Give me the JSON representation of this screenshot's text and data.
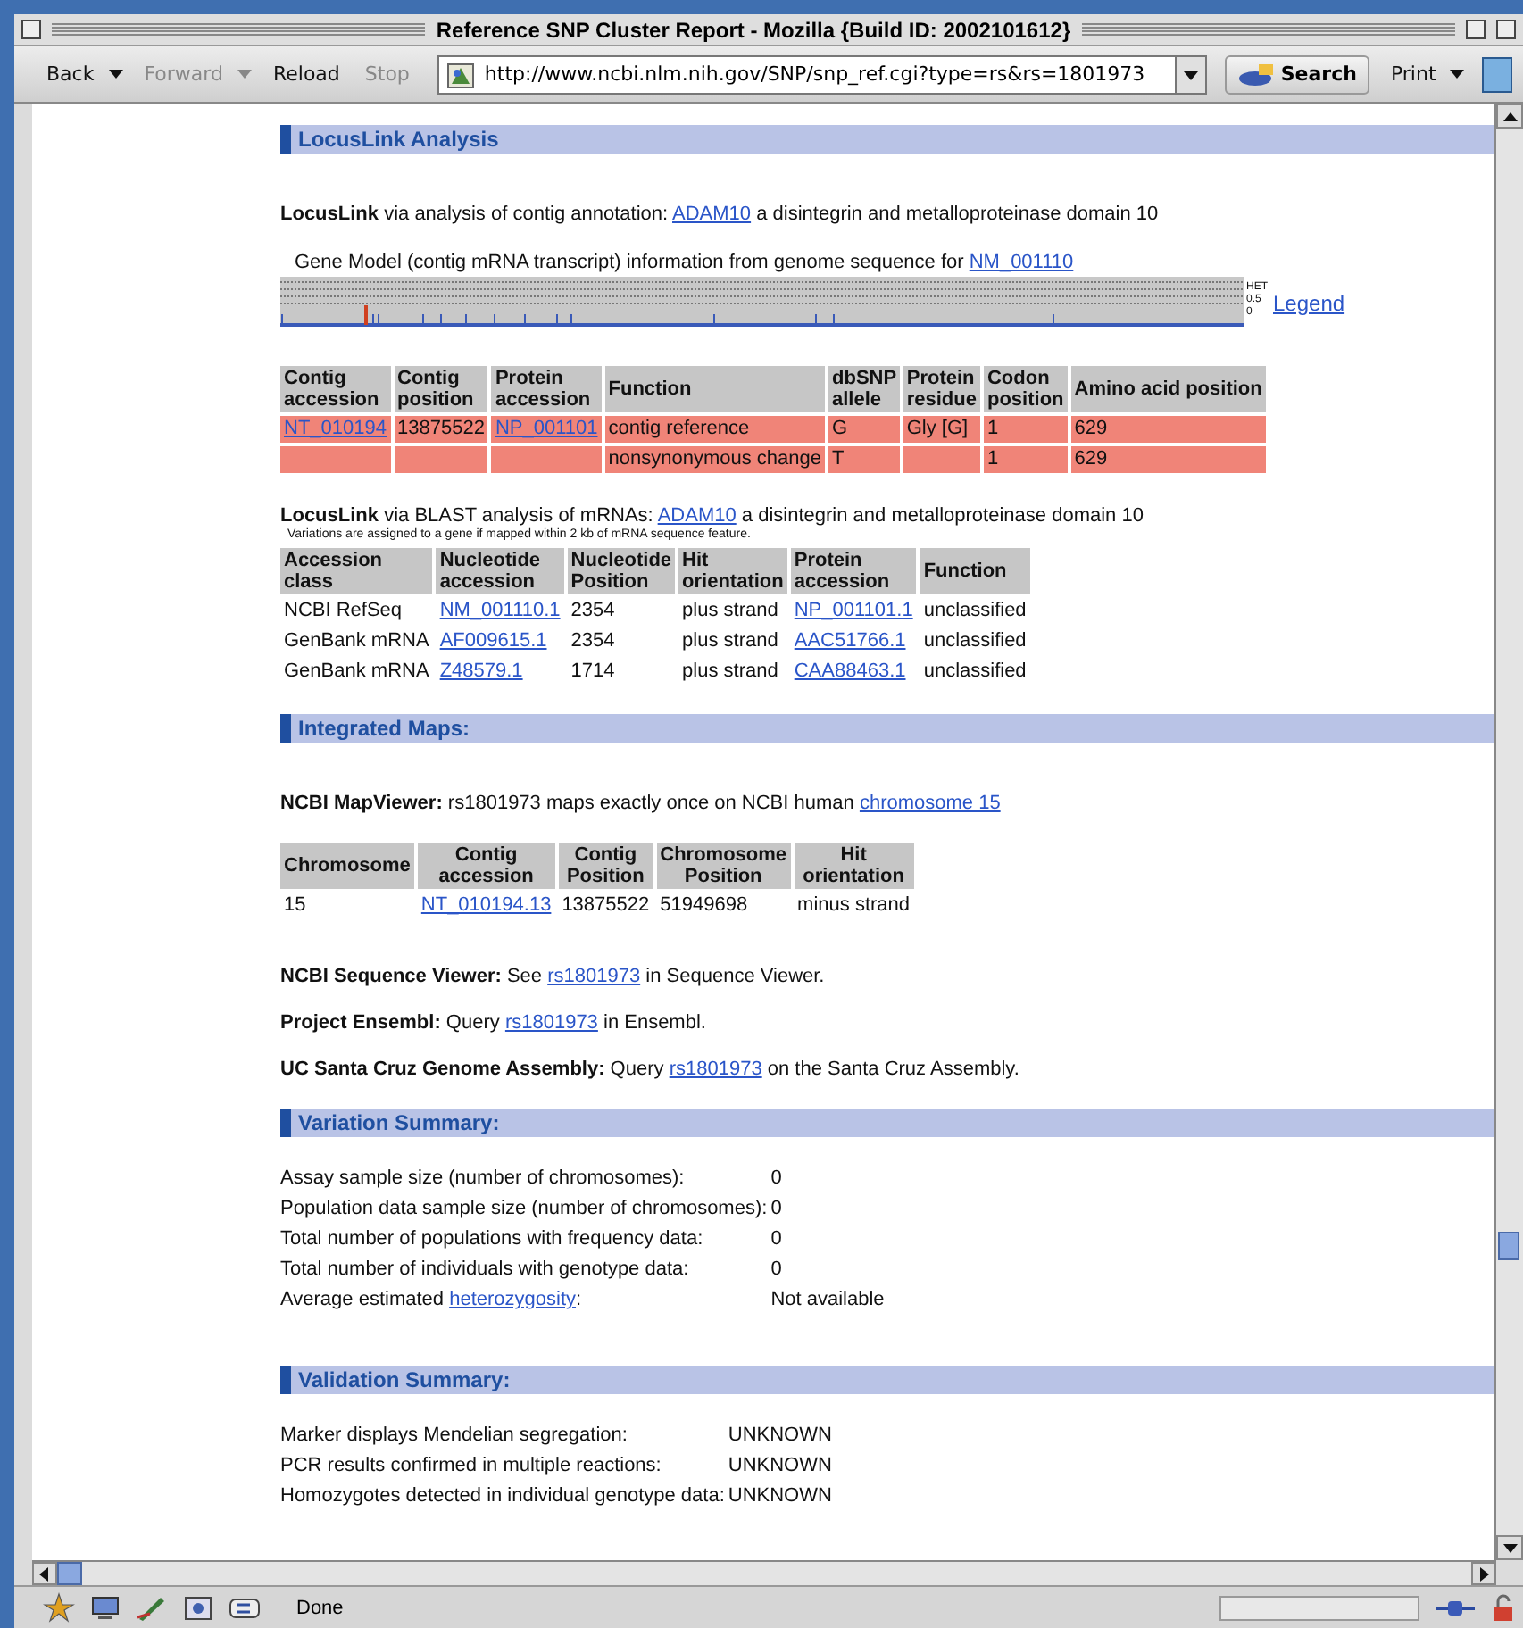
{
  "window": {
    "title": "Reference SNP Cluster Report - Mozilla {Build ID: 2002101612}"
  },
  "toolbar": {
    "buttons": [
      {
        "label": "Back",
        "disabled": false,
        "menu": true
      },
      {
        "label": "Forward",
        "disabled": true,
        "menu": true
      },
      {
        "label": "Reload",
        "disabled": false,
        "menu": false
      },
      {
        "label": "Stop",
        "disabled": true,
        "menu": false
      }
    ],
    "url": "http://www.ncbi.nlm.nih.gov/SNP/snp_ref.cgi?type=rs&rs=1801973",
    "search": "Search",
    "print": "Print"
  },
  "sections": [
    {
      "heading": "LocusLink Analysis",
      "blocks": [
        {
          "kind": "paragraph",
          "parts": [
            {
              "kind": "bold",
              "text": "LocusLink"
            },
            {
              "kind": "plain",
              "text": " via analysis of contig annotation: "
            },
            {
              "kind": "link",
              "text": "ADAM10"
            },
            {
              "kind": "plain",
              "text": " a disintegrin and metalloproteinase domain 10"
            }
          ]
        },
        {
          "kind": "gene_model",
          "parts": [
            {
              "kind": "plain",
              "text": "Gene Model (contig mRNA transcript) information from genome sequence for "
            },
            {
              "kind": "link",
              "text": "NM_001110"
            }
          ],
          "scale": [
            "HET",
            "0.5",
            "0"
          ],
          "legend": "Legend"
        },
        {
          "kind": "highlight_table",
          "columns": [
            "Contig accession",
            "Contig position",
            "Protein accession",
            "Function",
            "dbSNP allele",
            "Protein residue",
            "Codon position",
            "Amino acid position"
          ],
          "rows": [
            [
              {
                "kind": "link",
                "text": "NT_010194"
              },
              "13875522",
              {
                "kind": "link",
                "text": "NP_001101"
              },
              "contig reference",
              "G",
              "Gly [G]",
              "1",
              "629"
            ],
            [
              null,
              null,
              null,
              "nonsynonymous change",
              "T",
              null,
              "1",
              "629"
            ]
          ]
        },
        {
          "kind": "paragraph",
          "parts": [
            {
              "kind": "bold",
              "text": "LocusLink"
            },
            {
              "kind": "plain",
              "text": " via BLAST analysis of mRNAs: "
            },
            {
              "kind": "link",
              "text": "ADAM10"
            },
            {
              "kind": "plain",
              "text": " a disintegrin and metalloproteinase domain 10"
            }
          ]
        },
        {
          "kind": "note",
          "text": "Variations are assigned to a gene if mapped within 2 kb of mRNA sequence feature."
        },
        {
          "kind": "table",
          "columns": [
            "Accession class",
            "Nucleotide accession",
            "Nucleotide Position",
            "Hit orientation",
            "Protein accession",
            "Function"
          ],
          "rows": [
            [
              "NCBI RefSeq",
              {
                "kind": "link",
                "text": "NM_001110.1"
              },
              "2354",
              "plus strand",
              {
                "kind": "link",
                "text": "NP_001101.1"
              },
              "unclassified"
            ],
            [
              "GenBank mRNA",
              {
                "kind": "link",
                "text": "AF009615.1"
              },
              "2354",
              "plus strand",
              {
                "kind": "link",
                "text": "AAC51766.1"
              },
              "unclassified"
            ],
            [
              "GenBank mRNA",
              {
                "kind": "link",
                "text": "Z48579.1"
              },
              "1714",
              "plus strand",
              {
                "kind": "link",
                "text": "CAA88463.1"
              },
              "unclassified"
            ]
          ]
        }
      ]
    },
    {
      "heading": "Integrated Maps:",
      "blocks": [
        {
          "kind": "paragraph",
          "parts": [
            {
              "kind": "bold",
              "text": "NCBI MapViewer:"
            },
            {
              "kind": "plain",
              "text": "  rs1801973 maps exactly once on NCBI human "
            },
            {
              "kind": "link",
              "text": "chromosome 15"
            }
          ]
        },
        {
          "kind": "centered_table",
          "columns": [
            "Chromosome",
            "Contig accession",
            "Contig Position",
            "Chromosome Position",
            "Hit orientation"
          ],
          "rows": [
            [
              "15",
              {
                "kind": "link",
                "text": "NT_010194.13"
              },
              "13875522",
              "51949698",
              "minus strand"
            ]
          ]
        },
        {
          "kind": "paragraph",
          "parts": [
            {
              "kind": "bold",
              "text": "NCBI Sequence Viewer:"
            },
            {
              "kind": "plain",
              "text": " See "
            },
            {
              "kind": "link",
              "text": "rs1801973"
            },
            {
              "kind": "plain",
              "text": " in Sequence Viewer."
            }
          ]
        },
        {
          "kind": "paragraph",
          "parts": [
            {
              "kind": "bold",
              "text": "Project Ensembl:"
            },
            {
              "kind": "plain",
              "text": " Query "
            },
            {
              "kind": "link",
              "text": "rs1801973"
            },
            {
              "kind": "plain",
              "text": " in Ensembl."
            }
          ]
        },
        {
          "kind": "paragraph",
          "parts": [
            {
              "kind": "bold",
              "text": "UC Santa Cruz Genome Assembly:"
            },
            {
              "kind": "plain",
              "text": " Query "
            },
            {
              "kind": "link",
              "text": "rs1801973"
            },
            {
              "kind": "plain",
              "text": " on the Santa Cruz Assembly."
            }
          ]
        }
      ]
    },
    {
      "heading": "Variation Summary:",
      "blocks": [
        {
          "kind": "facts",
          "items": [
            {
              "label": [
                {
                  "kind": "plain",
                  "text": "Assay sample size (number of chromosomes):"
                }
              ],
              "value": "0"
            },
            {
              "label": [
                {
                  "kind": "plain",
                  "text": "Population data sample size (number of chromosomes):"
                }
              ],
              "value": "0"
            },
            {
              "label": [
                {
                  "kind": "plain",
                  "text": "Total number of populations with frequency data:"
                }
              ],
              "value": "0"
            },
            {
              "label": [
                {
                  "kind": "plain",
                  "text": "Total number of individuals with genotype data:"
                }
              ],
              "value": "0"
            },
            {
              "label": [
                {
                  "kind": "plain",
                  "text": "Average estimated "
                },
                {
                  "kind": "link",
                  "text": "heterozygosity"
                },
                {
                  "kind": "plain",
                  "text": ":"
                }
              ],
              "value": "Not available"
            }
          ]
        }
      ]
    },
    {
      "heading": "Validation Summary:",
      "blocks": [
        {
          "kind": "facts",
          "items": [
            {
              "label": [
                {
                  "kind": "plain",
                  "text": "Marker displays Mendelian segregation:"
                }
              ],
              "value": "UNKNOWN"
            },
            {
              "label": [
                {
                  "kind": "plain",
                  "text": "PCR results confirmed in multiple reactions:"
                }
              ],
              "value": "UNKNOWN"
            },
            {
              "label": [
                {
                  "kind": "plain",
                  "text": "Homozygotes detected in individual genotype data:"
                }
              ],
              "value": "UNKNOWN"
            }
          ]
        }
      ]
    }
  ],
  "status_bar": {
    "text": "Done"
  }
}
